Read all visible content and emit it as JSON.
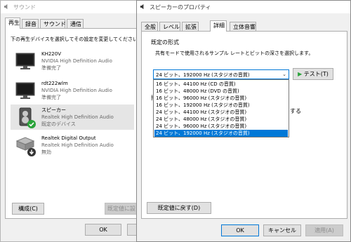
{
  "sound_window": {
    "title": "サウンド",
    "tabs": [
      "再生",
      "録音",
      "サウンド",
      "通信"
    ],
    "instruction": "下の再生デバイスを選択してその設定を変更してください:",
    "devices": [
      {
        "name": "KH220V",
        "driver": "NVIDIA High Definition Audio",
        "status": "準備完了"
      },
      {
        "name": "rdt222wlm",
        "driver": "NVIDIA High Definition Audio",
        "status": "準備完了"
      },
      {
        "name": "スピーカー",
        "driver": "Realtek High Definition Audio",
        "status": "既定のデバイス"
      },
      {
        "name": "Realtek Digital Output",
        "driver": "Realtek High Definition Audio",
        "status": "無効"
      }
    ],
    "configure_label": "構成(C)",
    "set_default_label": "既定値に設",
    "ok_label": "OK"
  },
  "props_window": {
    "title": "スピーカーのプロパティ",
    "tabs": [
      "全般",
      "レベル",
      "拡張",
      "詳細",
      "立体音響"
    ],
    "format_group_label": "既定の形式",
    "format_description": "共有モードで使用されるサンプル レートとビットの深さを選択します。",
    "selected_format": "24 ビット、192000 Hz (スタジオの音質)",
    "test_label": "テスト(T)",
    "options": [
      "16 ビット、44100 Hz (CD の音質)",
      "16 ビット、48000 Hz (DVD の音質)",
      "16 ビット、96000 Hz (スタジオの音質)",
      "16 ビット、192000 Hz (スタジオの音質)",
      "24 ビット、44100 Hz (スタジオの音質)",
      "24 ビット、48000 Hz (スタジオの音質)",
      "24 ビット、96000 Hz (スタジオの音質)",
      "24 ビット、192000 Hz (スタジオの音質)"
    ],
    "partial_text_1": "排",
    "partial_text_2": "する",
    "restore_defaults_label": "既定値に戻す(D)",
    "ok_label": "OK",
    "cancel_label": "キャンセル",
    "apply_label": "適用(A)"
  },
  "colors": {
    "accent": "#0078d7",
    "check_green": "#2aa33a"
  }
}
